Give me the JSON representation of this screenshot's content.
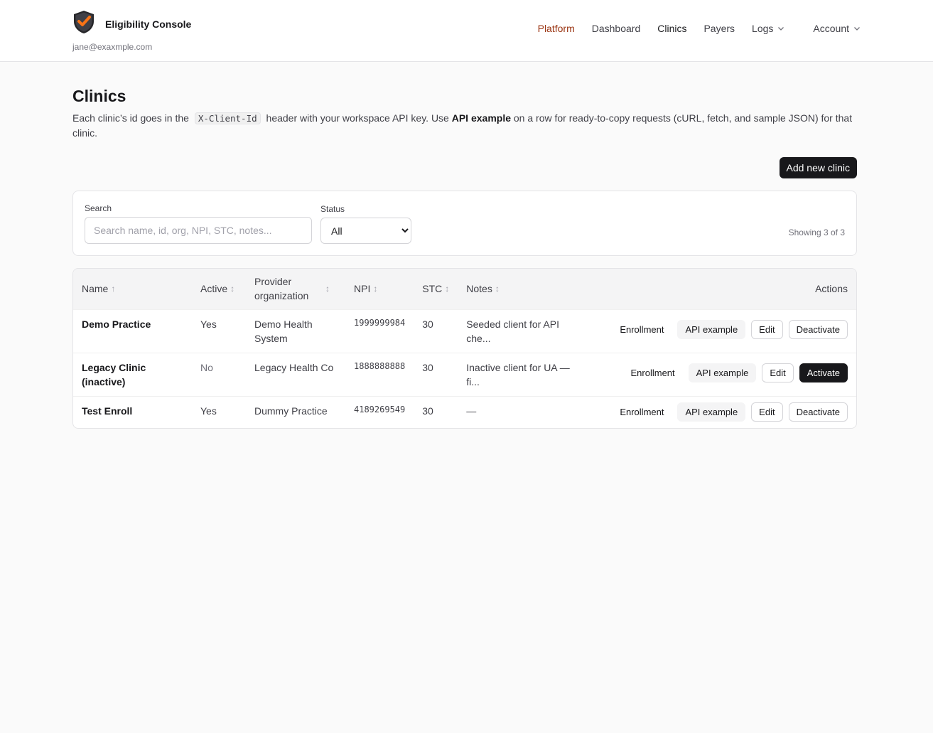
{
  "header": {
    "brand_title": "Eligibility Console",
    "user_email": "jane@exaxmple.com",
    "nav": {
      "platform": "Platform",
      "dashboard": "Dashboard",
      "clinics": "Clinics",
      "payers": "Payers",
      "logs": "Logs",
      "account": "Account"
    },
    "accent_color": "#9a3412"
  },
  "page": {
    "title": "Clinics",
    "desc_1": "Each clinic’s id goes in the",
    "desc_code": "X-Client-Id",
    "desc_2": "header with your workspace API key. Use",
    "desc_bold": "API example",
    "desc_3": "on a row for ready-to-copy requests (cURL, fetch, and sample JSON) for that clinic.",
    "add_button": "Add new clinic"
  },
  "filters": {
    "search_label": "Search",
    "search_placeholder": "Search name, id, org, NPI, STC, notes...",
    "search_value": "",
    "status_label": "Status",
    "status_selected": "All",
    "showing": "Showing 3 of 3"
  },
  "table": {
    "columns": {
      "name": "Name",
      "active": "Active",
      "org": "Provider organization",
      "npi": "NPI",
      "stc": "STC",
      "notes": "Notes",
      "actions": "Actions"
    },
    "rows": [
      {
        "name": "Demo Practice",
        "active": "Yes",
        "org": "Demo Health System",
        "npi": "1999999984",
        "stc": "30",
        "notes": "Seeded client for API che...",
        "enroll": "Enrollment",
        "api": "API example",
        "edit": "Edit",
        "toggle": "Deactivate"
      },
      {
        "name": "Legacy Clinic (inactive)",
        "active": "No",
        "org": "Legacy Health Co",
        "npi": "1888888888",
        "stc": "30",
        "notes": "Inactive client for UA — fi...",
        "enroll": "Enrollment",
        "api": "API example",
        "edit": "Edit",
        "toggle": "Activate"
      },
      {
        "name": "Test Enroll",
        "active": "Yes",
        "org": "Dummy Practice",
        "npi": "4189269549",
        "stc": "30",
        "notes": "—",
        "enroll": "Enrollment",
        "api": "API example",
        "edit": "Edit",
        "toggle": "Deactivate"
      }
    ]
  }
}
